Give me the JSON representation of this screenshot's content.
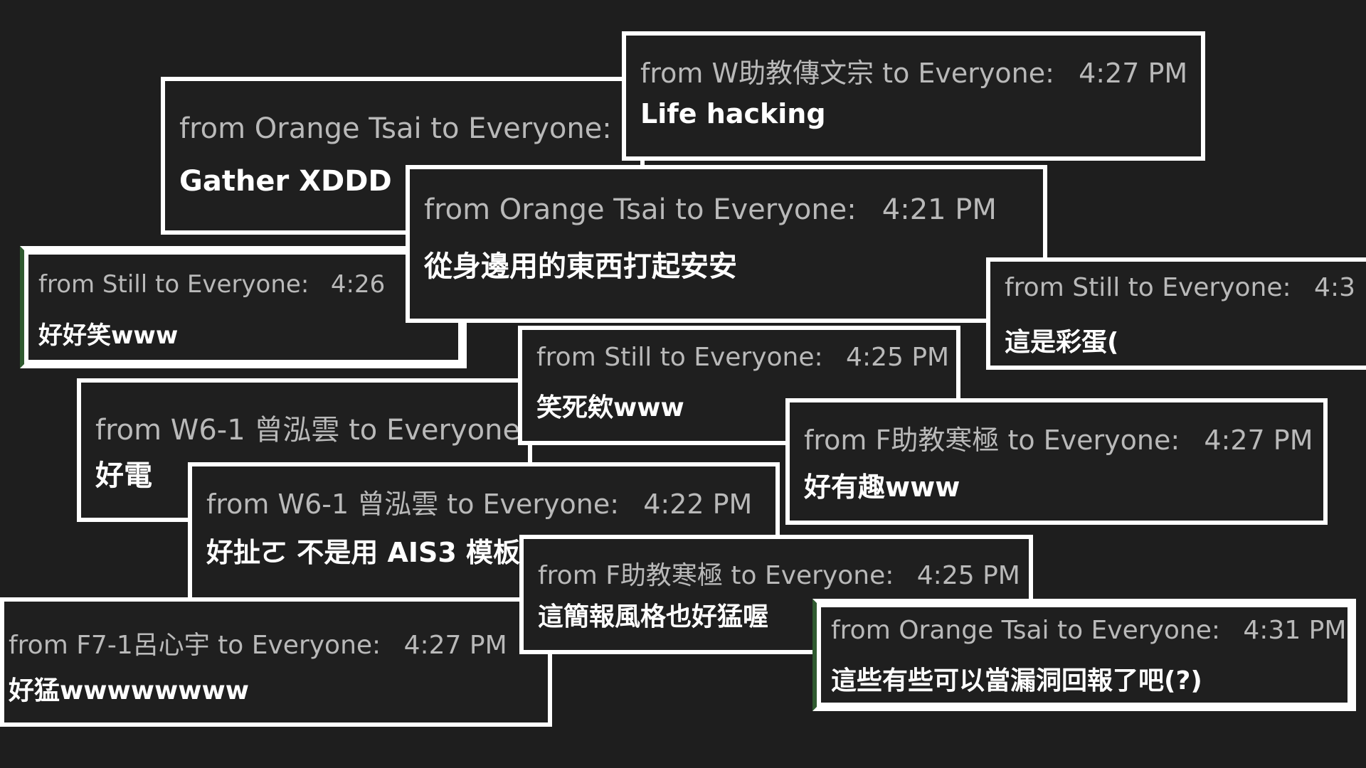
{
  "chat_messages": [
    {
      "id": "m1",
      "header": "from W助教傳文宗 to Everyone:",
      "time": "4:27  PM",
      "text": "Life hacking"
    },
    {
      "id": "m2",
      "header": "from Orange Tsai to Everyone:",
      "time": "",
      "text": "Gather XDDD"
    },
    {
      "id": "m3",
      "header": "from Orange Tsai to Everyone:",
      "time": "4:21  PM",
      "text": "從身邊用的東西打起安安"
    },
    {
      "id": "m4",
      "header": "from Still to Everyone:",
      "time": "4:26",
      "text": "好好笑www"
    },
    {
      "id": "m5",
      "header": "from Still to Everyone:",
      "time": "4:3",
      "text": "這是彩蛋("
    },
    {
      "id": "m6",
      "header": "from Still to Everyone:",
      "time": "4:25  PM",
      "text": "笑死欸www"
    },
    {
      "id": "m7",
      "header": "from W6-1 曾泓雲 to Everyone:",
      "time": "",
      "text": "好電"
    },
    {
      "id": "m8",
      "header": "from F助教寒極 to Everyone:",
      "time": "4:27  PM",
      "text": "好有趣www"
    },
    {
      "id": "m9",
      "header": "from W6-1 曾泓雲 to Everyone:",
      "time": "4:22  PM",
      "text": "好扯ㄛ 不是用 AIS3 模板"
    },
    {
      "id": "m10",
      "header": "from F助教寒極 to Everyone:",
      "time": "4:25  PM",
      "text": "這簡報風格也好猛喔"
    },
    {
      "id": "m11",
      "header": "from F7-1呂心宇 to Everyone:",
      "time": "4:27  PM",
      "text": "好猛wwwwwwww"
    },
    {
      "id": "m12",
      "header": "from Orange Tsai to Everyone:",
      "time": "4:31  PM",
      "text": "這些有些可以當漏洞回報了吧(?)"
    }
  ]
}
